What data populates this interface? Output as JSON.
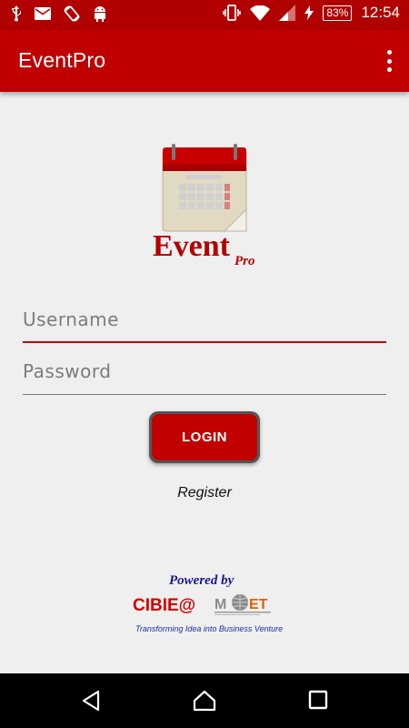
{
  "status_bar": {
    "battery_percent": "83%",
    "time": "12:54",
    "left_icons": [
      "usb-icon",
      "mail-icon",
      "rotate-icon",
      "android-icon"
    ],
    "right_icons": [
      "vibrate-icon",
      "wifi-icon",
      "signal-icon",
      "charging-icon"
    ]
  },
  "app_bar": {
    "title": "EventPro",
    "menu_icon": "more-vert-icon"
  },
  "logo": {
    "word": "Event",
    "sub": "Pro"
  },
  "form": {
    "username_placeholder": "Username",
    "password_placeholder": "Password",
    "login_label": "LOGIN",
    "register_label": "Register"
  },
  "footer": {
    "powered_by": "Powered by",
    "brand": "CIBIE@",
    "partner": "MOET",
    "tagline": "Transforming Idea into Business Venture"
  },
  "colors": {
    "primary": "#c00000",
    "status_bar": "#b00000",
    "background": "#efefef"
  }
}
